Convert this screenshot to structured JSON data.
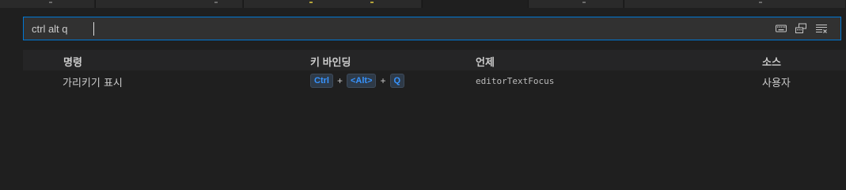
{
  "search": {
    "value": "ctrl alt q"
  },
  "table": {
    "headers": {
      "command": "명령",
      "keybinding": "키 바인딩",
      "when": "언제",
      "source": "소스"
    },
    "rows": [
      {
        "command": "가리키기 표시",
        "keys": [
          "Ctrl",
          "<Alt>",
          "Q"
        ],
        "separator": "+",
        "when": "editorTextFocus",
        "source": "사용자"
      }
    ]
  },
  "icons": {
    "record_keys": "keyboard-icon",
    "sort_by_precedence": "sort-precedence-icon",
    "clear_input": "clear-filter-icon"
  },
  "colors": {
    "background": "#1f1f1f",
    "focus_border": "#0078d4",
    "key_text": "#3794ff",
    "key_bg": "#2e3a48"
  }
}
